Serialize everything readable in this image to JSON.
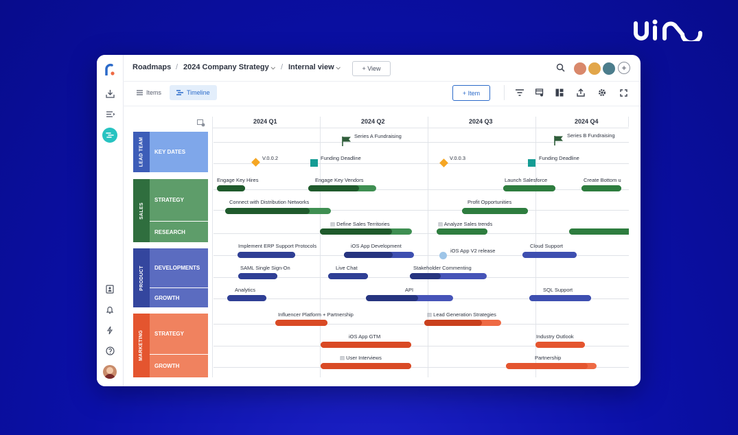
{
  "colors": {
    "brand_bg": "#0b10a8",
    "accent": "#2b6ac9",
    "teal": "#27c3c1",
    "lead": "#7fa7ea",
    "sales": "#3f8f52",
    "product": "#3e4fb0",
    "marketing": "#ee6a44"
  },
  "brand": {
    "wordmark": "uim"
  },
  "header": {
    "crumbs": [
      "Roadmaps",
      "2024 Company Strategy",
      "Internal view"
    ],
    "view_button": "+ View"
  },
  "toolbar": {
    "tabs": [
      {
        "label": "Items",
        "active": false
      },
      {
        "label": "Timeline",
        "active": true
      }
    ],
    "item_button": "+ Item",
    "icons": [
      "filter-icon",
      "card-settings-icon",
      "layout-icon",
      "export-icon",
      "gear-icon",
      "fullscreen-icon"
    ]
  },
  "timeline": {
    "quarters": [
      "2024 Q1",
      "2024 Q2",
      "2024 Q3",
      "2024 Q4"
    ],
    "groups": [
      {
        "label": "LEAD TEAM",
        "lanes": [
          "KEY DATES"
        ]
      },
      {
        "label": "SALES",
        "lanes": [
          "STRATEGY",
          "RESEARCH"
        ]
      },
      {
        "label": "PRODUCT",
        "lanes": [
          "DEVELOPMENTS",
          "GROWTH"
        ]
      },
      {
        "label": "MARKETING",
        "lanes": [
          "STRATEGY",
          "GROWTH"
        ]
      }
    ],
    "milestones": [
      {
        "label": "Series A Fundraising",
        "type": "flag"
      },
      {
        "label": "Series B Fundraising",
        "type": "flag"
      },
      {
        "label": "V.0.0.2",
        "type": "diamond"
      },
      {
        "label": "Funding Deadline",
        "type": "square"
      },
      {
        "label": "V.0.0.3",
        "type": "diamond"
      },
      {
        "label": "Funding Deadline",
        "type": "square"
      },
      {
        "label": "iOS App V2 release",
        "type": "circle"
      }
    ],
    "bars": [
      {
        "label": "Engage Key Hires",
        "progress": 1.0
      },
      {
        "label": "Engage Key Vendors",
        "progress": 0.75
      },
      {
        "label": "Launch Salesforce",
        "progress": 1.0
      },
      {
        "label": "Create Bottom u",
        "progress": 1.0
      },
      {
        "label": "Connect with Distribution Networks",
        "progress": 0.8
      },
      {
        "label": "Profit Opportunities",
        "progress": 1.0
      },
      {
        "label": "Define Sales Territories",
        "progress": 0.78
      },
      {
        "label": "Analyze Sales trends",
        "progress": 1.0
      },
      {
        "label": "",
        "progress": 1.0
      },
      {
        "label": "Implement ERP Support Protocols",
        "progress": 1.0
      },
      {
        "label": "iOS App Development",
        "progress": 0.7
      },
      {
        "label": "Cloud Support",
        "progress": 1.0
      },
      {
        "label": "SAML Single Sign-On",
        "progress": 1.0
      },
      {
        "label": "Live Chat",
        "progress": 1.0
      },
      {
        "label": "Stakeholder Commenting",
        "progress": 0.4
      },
      {
        "label": "Analytics",
        "progress": 1.0
      },
      {
        "label": "API",
        "progress": 0.6
      },
      {
        "label": "SQL Support",
        "progress": 1.0
      },
      {
        "label": "Influencer Platform + Partnership",
        "progress": 1.0
      },
      {
        "label": "Lead Generation Strategies",
        "progress": 0.75
      },
      {
        "label": "iOS App GTM",
        "progress": 1.0
      },
      {
        "label": "Industry Outlook",
        "progress": 1.0
      },
      {
        "label": "User Interviews",
        "progress": 1.0
      },
      {
        "label": "Partnership",
        "progress": 0.9
      }
    ]
  }
}
